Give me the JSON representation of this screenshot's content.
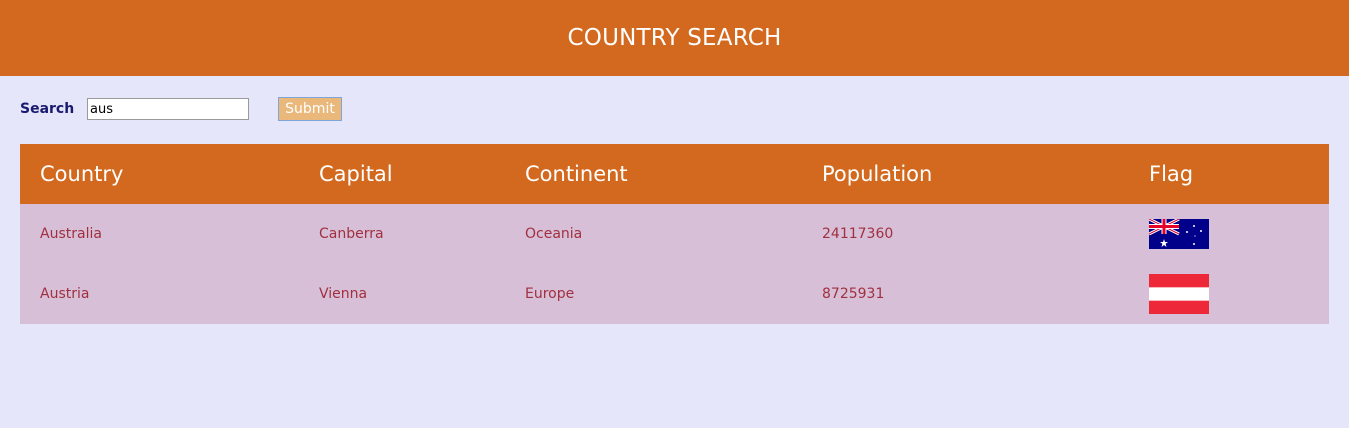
{
  "header": {
    "title": "COUNTRY SEARCH"
  },
  "search": {
    "label": "Search",
    "value": "aus",
    "submit_label": "Submit"
  },
  "table": {
    "columns": [
      "Country",
      "Capital",
      "Continent",
      "Population",
      "Flag"
    ],
    "rows": [
      {
        "country": "Australia",
        "capital": "Canberra",
        "continent": "Oceania",
        "population": "24117360",
        "flag": "australia-flag-icon"
      },
      {
        "country": "Austria",
        "capital": "Vienna",
        "continent": "Europe",
        "population": "8725931",
        "flag": "austria-flag-icon"
      }
    ]
  },
  "colors": {
    "header_bg": "#d2691e",
    "page_bg": "#e6e6fa",
    "row_bg": "#d8bfd8",
    "row_text": "#a0303f",
    "label_text": "#191970",
    "button_bg": "#e9b87a"
  }
}
